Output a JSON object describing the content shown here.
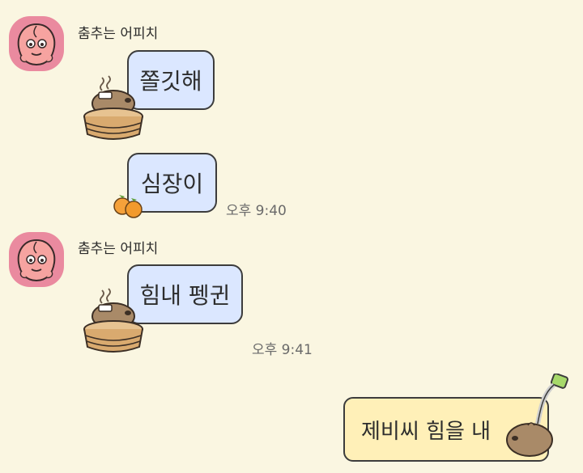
{
  "chat": {
    "messages": [
      {
        "sender": "춤추는 어피치",
        "text": "쫄깃해"
      },
      {
        "text": "심장이",
        "time": "오후 9:40"
      },
      {
        "sender": "춤추는 어피치",
        "text": "힘내 펭귄",
        "time": "오후 9:41"
      },
      {
        "text": "제비씨 힘을 내"
      }
    ]
  },
  "icons": {
    "avatar": "peach-character-icon",
    "sticker_1": "capybara-bath-icon",
    "sticker_2": "orange-fruit-icon",
    "sticker_3": "capybara-bath-icon",
    "sticker_4": "capybara-drinking-icon"
  },
  "colors": {
    "background": "#faf6e1",
    "incoming_bubble": "#dbe7ff",
    "outgoing_bubble": "#fff0b8",
    "avatar_bg": "#ea8a9f"
  }
}
